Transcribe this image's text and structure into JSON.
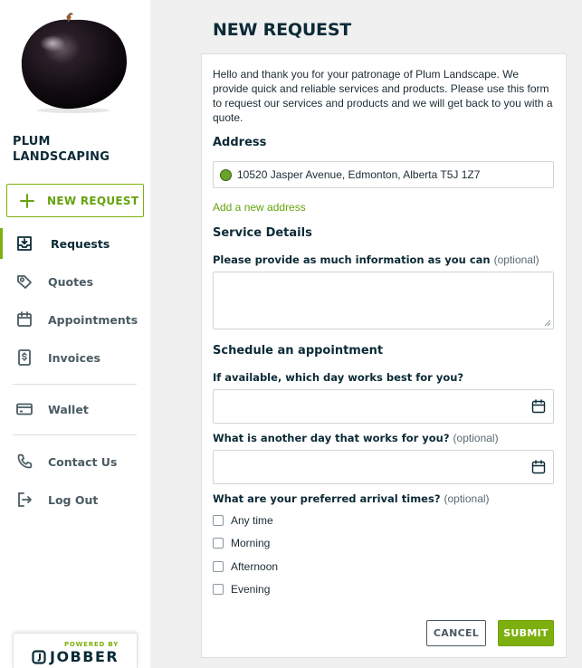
{
  "sidebar": {
    "company_name": "PLUM LANDSCAPING",
    "new_request_label": "NEW REQUEST",
    "nav": [
      {
        "label": "Requests",
        "icon": "inbox-download-icon",
        "active": true
      },
      {
        "label": "Quotes",
        "icon": "quote-icon"
      },
      {
        "label": "Appointments",
        "icon": "calendar-icon"
      },
      {
        "label": "Invoices",
        "icon": "invoice-dollar-icon"
      },
      {
        "label": "Wallet",
        "icon": "credit-card-icon"
      },
      {
        "label": "Contact Us",
        "icon": "phone-icon"
      },
      {
        "label": "Log Out",
        "icon": "logout-icon"
      }
    ],
    "powered_by": "POWERED BY",
    "brand": "JOBBER"
  },
  "main": {
    "title": "NEW REQUEST",
    "intro": "Hello and thank you for your patronage of Plum Landscape. We provide quick and reliable services and products. Please use this form to request our services and products and we will get back to you with a quote.",
    "address_heading": "Address",
    "address_value": "10520 Jasper Avenue, Edmonton, Alberta T5J 1Z7",
    "add_address_link": "Add a new address",
    "service_heading": "Service Details",
    "service_question": "Please provide as much information as you can",
    "optional": "(optional)",
    "service_value": "",
    "schedule_heading": "Schedule an appointment",
    "day_question": "If available, which day works best for you?",
    "another_day_question": "What is another day that works for you?",
    "arrival_question": "What are your preferred arrival times?",
    "arrival_options": [
      "Any time",
      "Morning",
      "Afternoon",
      "Evening"
    ],
    "cancel_label": "CANCEL",
    "submit_label": "SUBMIT"
  },
  "colors": {
    "accent": "#7db00e",
    "navy": "#0b2a36",
    "background": "#f0f0f0"
  }
}
